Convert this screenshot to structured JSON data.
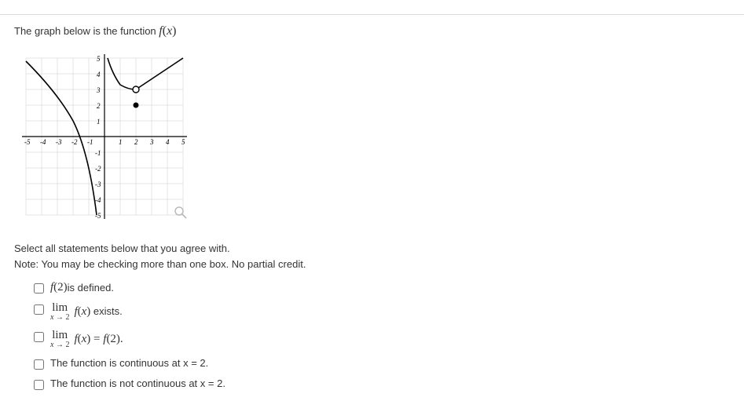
{
  "prompt": {
    "prefix": "The graph below is the function ",
    "function_label": "f(x)"
  },
  "chart_data": {
    "type": "line",
    "xlim": [
      -5,
      5
    ],
    "ylim": [
      -5,
      5
    ],
    "x_ticks": [
      -5,
      -4,
      -3,
      -2,
      -1,
      1,
      2,
      3,
      4,
      5
    ],
    "y_ticks": [
      -5,
      -4,
      -3,
      -2,
      -1,
      1,
      2,
      3,
      4,
      5
    ],
    "series": [
      {
        "name": "left-branch",
        "description": "curve descending from upper-left approaching y-axis asymptote",
        "points": [
          [
            -5,
            4.8
          ],
          [
            -4,
            4.0
          ],
          [
            -3,
            2.8
          ],
          [
            -2,
            1.0
          ],
          [
            -1,
            -2.2
          ],
          [
            -0.5,
            -5
          ]
        ]
      },
      {
        "name": "right-branch",
        "description": "curve from just right of y-axis up to open circle at (2,3) then continuing upper right",
        "points": [
          [
            0.2,
            5
          ],
          [
            0.5,
            4.2
          ],
          [
            1,
            3.3
          ],
          [
            1.5,
            3.05
          ],
          [
            2,
            3
          ],
          [
            3,
            3.6
          ],
          [
            4,
            4.3
          ],
          [
            5,
            5
          ]
        ]
      }
    ],
    "open_points": [
      [
        2,
        3
      ]
    ],
    "closed_points": [
      [
        2,
        2
      ]
    ]
  },
  "instruction": {
    "line1": "Select all statements below that you agree with.",
    "line2": "Note: You may be checking more than one box. No partial credit."
  },
  "options": {
    "opt1": {
      "f": "f",
      "arg": "(2)",
      "suffix": " is defined."
    },
    "opt2": {
      "lim": "lim",
      "sub": "x → 2",
      "f": "f",
      "arg": "(x)",
      "suffix": " exists."
    },
    "opt3": {
      "lim": "lim",
      "sub": "x → 2",
      "f": "f",
      "arg": "(x)",
      "eq": " = ",
      "f2": "f",
      "arg2": "(2)."
    },
    "opt4": "The function is continuous at x = 2.",
    "opt5": "The function is not continuous at x = 2."
  }
}
